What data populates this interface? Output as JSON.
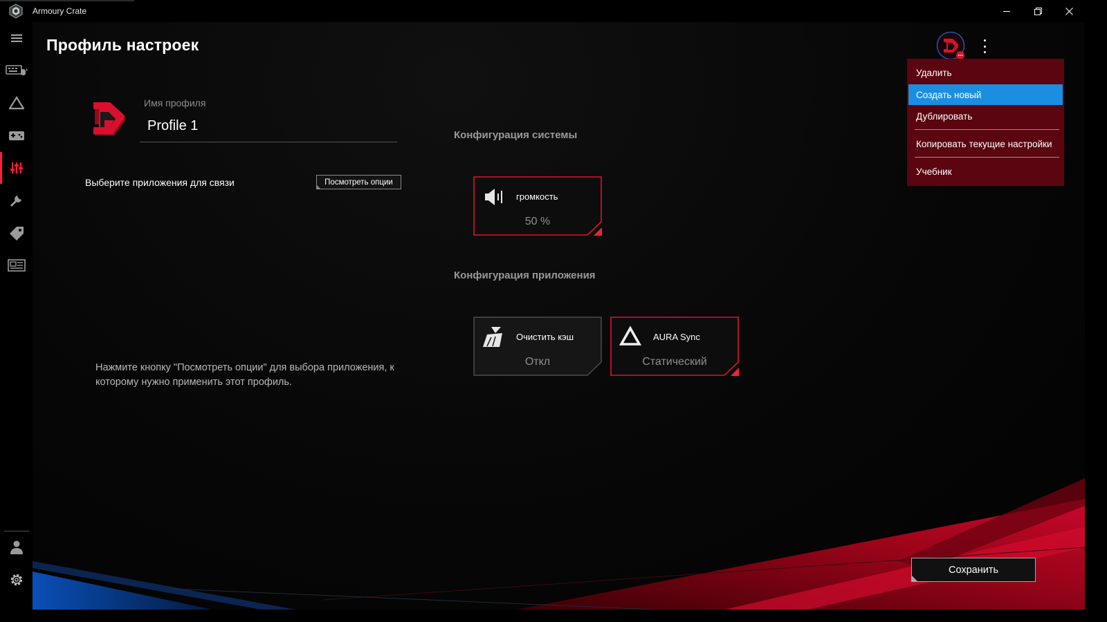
{
  "window": {
    "title": "Armoury Crate",
    "minimize_icon": "minimize-icon",
    "restore_icon": "restore-icon",
    "close_icon": "close-icon"
  },
  "sidebar": {
    "items": [
      {
        "name": "menu",
        "icon": "hamburger-icon"
      },
      {
        "name": "device",
        "icon": "keyboard-icon"
      },
      {
        "name": "aura",
        "icon": "aura-icon"
      },
      {
        "name": "game-library",
        "icon": "gamepad-icon"
      },
      {
        "name": "scenario-profiles",
        "icon": "sliders-icon",
        "active": true
      },
      {
        "name": "tools",
        "icon": "wrench-icon"
      },
      {
        "name": "deals",
        "icon": "tag-icon"
      },
      {
        "name": "news",
        "icon": "news-icon"
      },
      {
        "name": "user",
        "icon": "user-icon"
      },
      {
        "name": "settings",
        "icon": "gear-icon"
      }
    ]
  },
  "page": {
    "title": "Профиль настроек"
  },
  "profile": {
    "name_label": "Имя профиля",
    "name_value": "Profile 1"
  },
  "apps": {
    "choose_label": "Выберите приложения для связи",
    "view_options_button": "Посмотреть опции",
    "hint": "Нажмите кнопку \"Посмотреть опции\" для выбора приложения, к которому нужно применить этот профиль."
  },
  "system_config": {
    "title": "Конфигурация системы",
    "cards": [
      {
        "title": "громкость",
        "value": "50 %",
        "icon": "speaker-icon",
        "active": true
      }
    ]
  },
  "app_config": {
    "title": "Конфигурация приложения",
    "cards": [
      {
        "title": "Очистить кэш",
        "value": "Откл",
        "icon": "broom-icon",
        "active": false
      },
      {
        "title": "AURA Sync",
        "value": "Статический",
        "icon": "aura-sync-icon",
        "active": true
      }
    ]
  },
  "menu": {
    "items": [
      {
        "label": "Удалить"
      },
      {
        "label": "Создать новый",
        "highlighted": true
      },
      {
        "label": "Дублировать"
      },
      {
        "label": "Копировать текущие настройки"
      },
      {
        "label": "Учебник"
      }
    ]
  },
  "footer": {
    "save_button": "Сохранить"
  },
  "colors": {
    "accent_red": "#ff1d3a",
    "menu_background": "#5a0510",
    "menu_highlight": "#1a8ee0"
  }
}
